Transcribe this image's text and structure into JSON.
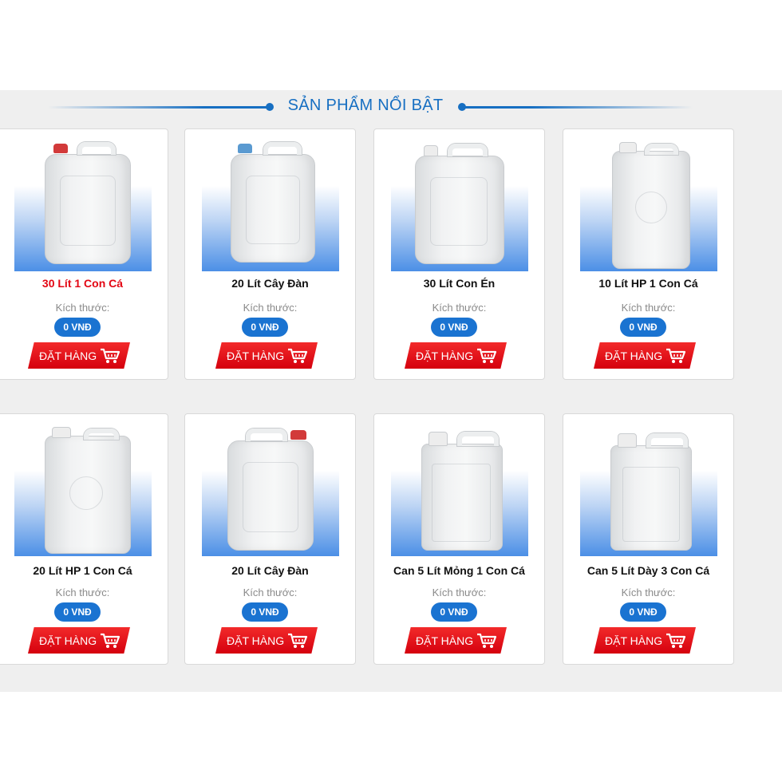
{
  "section": {
    "title": "SẢN PHẨM NỔI BẬT",
    "accent_color": "#176fc2",
    "order_color": "#e30613",
    "price_color": "#1a73d1"
  },
  "products": [
    {
      "name": "30 Lít 1 Con Cá",
      "size_label": "Kích thước:",
      "price": "0 VNĐ",
      "order_label": "ĐẶT HÀNG",
      "image_icon": "jerrycan-30l-red-cap"
    },
    {
      "name": "20 Lít Cây Đàn",
      "size_label": "Kích thước:",
      "price": "0 VNĐ",
      "order_label": "ĐẶT HÀNG",
      "image_icon": "jerrycan-20l-blue-cap"
    },
    {
      "name": "30 Lít Con Én",
      "size_label": "Kích thước:",
      "price": "0 VNĐ",
      "order_label": "ĐẶT HÀNG",
      "image_icon": "jerrycan-30l-white-cap"
    },
    {
      "name": "10 Lít HP 1 Con Cá",
      "size_label": "Kích thước:",
      "price": "0 VNĐ",
      "order_label": "ĐẶT HÀNG",
      "image_icon": "jerrycan-10l-tall"
    },
    {
      "name": "20 Lít HP 1 Con Cá",
      "size_label": "Kích thước:",
      "price": "0 VNĐ",
      "order_label": "ĐẶT HÀNG",
      "image_icon": "jerrycan-20l-tall"
    },
    {
      "name": "20 Lít Cây Đàn",
      "size_label": "Kích thước:",
      "price": "0 VNĐ",
      "order_label": "ĐẶT HÀNG",
      "image_icon": "jerrycan-20l-red-cap"
    },
    {
      "name": "Can 5 Lít Mỏng 1 Con Cá",
      "size_label": "Kích thước:",
      "price": "0 VNĐ",
      "order_label": "ĐẶT HÀNG",
      "image_icon": "jug-5l-thin"
    },
    {
      "name": "Can 5 Lít Dày 3 Con Cá",
      "size_label": "Kích thước:",
      "price": "0 VNĐ",
      "order_label": "ĐẶT HÀNG",
      "image_icon": "jug-5l-thick"
    }
  ],
  "icons": {
    "cart": "shopping-cart-icon"
  }
}
